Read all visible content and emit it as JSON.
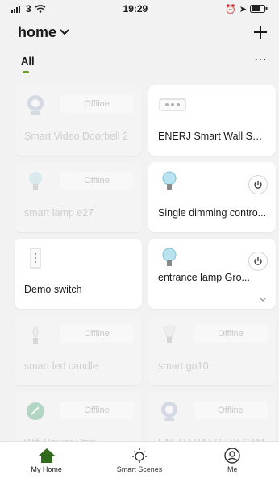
{
  "status": {
    "signal": "3",
    "time": "19:29"
  },
  "header": {
    "title": "home"
  },
  "tabs": {
    "active": "All"
  },
  "devices": [
    {
      "name": "Smart Video Doorbell 2",
      "status": "Offline",
      "offline": true,
      "icon": "camera-icon"
    },
    {
      "name": "ENERJ Smart Wall Soc...",
      "status": "",
      "offline": false,
      "icon": "socket-icon"
    },
    {
      "name": "smart lamp e27",
      "status": "Offline",
      "offline": true,
      "icon": "bulb-icon"
    },
    {
      "name": "Single dimming contro...",
      "status": "",
      "offline": false,
      "icon": "bulb-icon"
    },
    {
      "name": "Demo switch",
      "status": "",
      "offline": false,
      "icon": "switch-icon"
    },
    {
      "name": "entrance lamp Gro...",
      "status": "",
      "offline": false,
      "icon": "bulb-icon"
    },
    {
      "name": "smart led candle",
      "status": "Offline",
      "offline": true,
      "icon": "candle-icon"
    },
    {
      "name": "smart gu10",
      "status": "Offline",
      "offline": true,
      "icon": "bulb-icon"
    },
    {
      "name": "Wifi Power Strip",
      "status": "Offline",
      "offline": true,
      "icon": "power-strip-icon"
    },
    {
      "name": "ENERJ BATTERY CAM",
      "status": "Offline",
      "offline": true,
      "icon": "camera-icon"
    }
  ],
  "nav": [
    {
      "label": "My Home",
      "icon": "home-icon",
      "active": true
    },
    {
      "label": "Smart Scenes",
      "icon": "sun-icon",
      "active": false
    },
    {
      "label": "Me",
      "icon": "profile-icon",
      "active": false
    }
  ],
  "colors": {
    "accent": "#6a9a2b",
    "nav_active": "#2f6b1b"
  }
}
